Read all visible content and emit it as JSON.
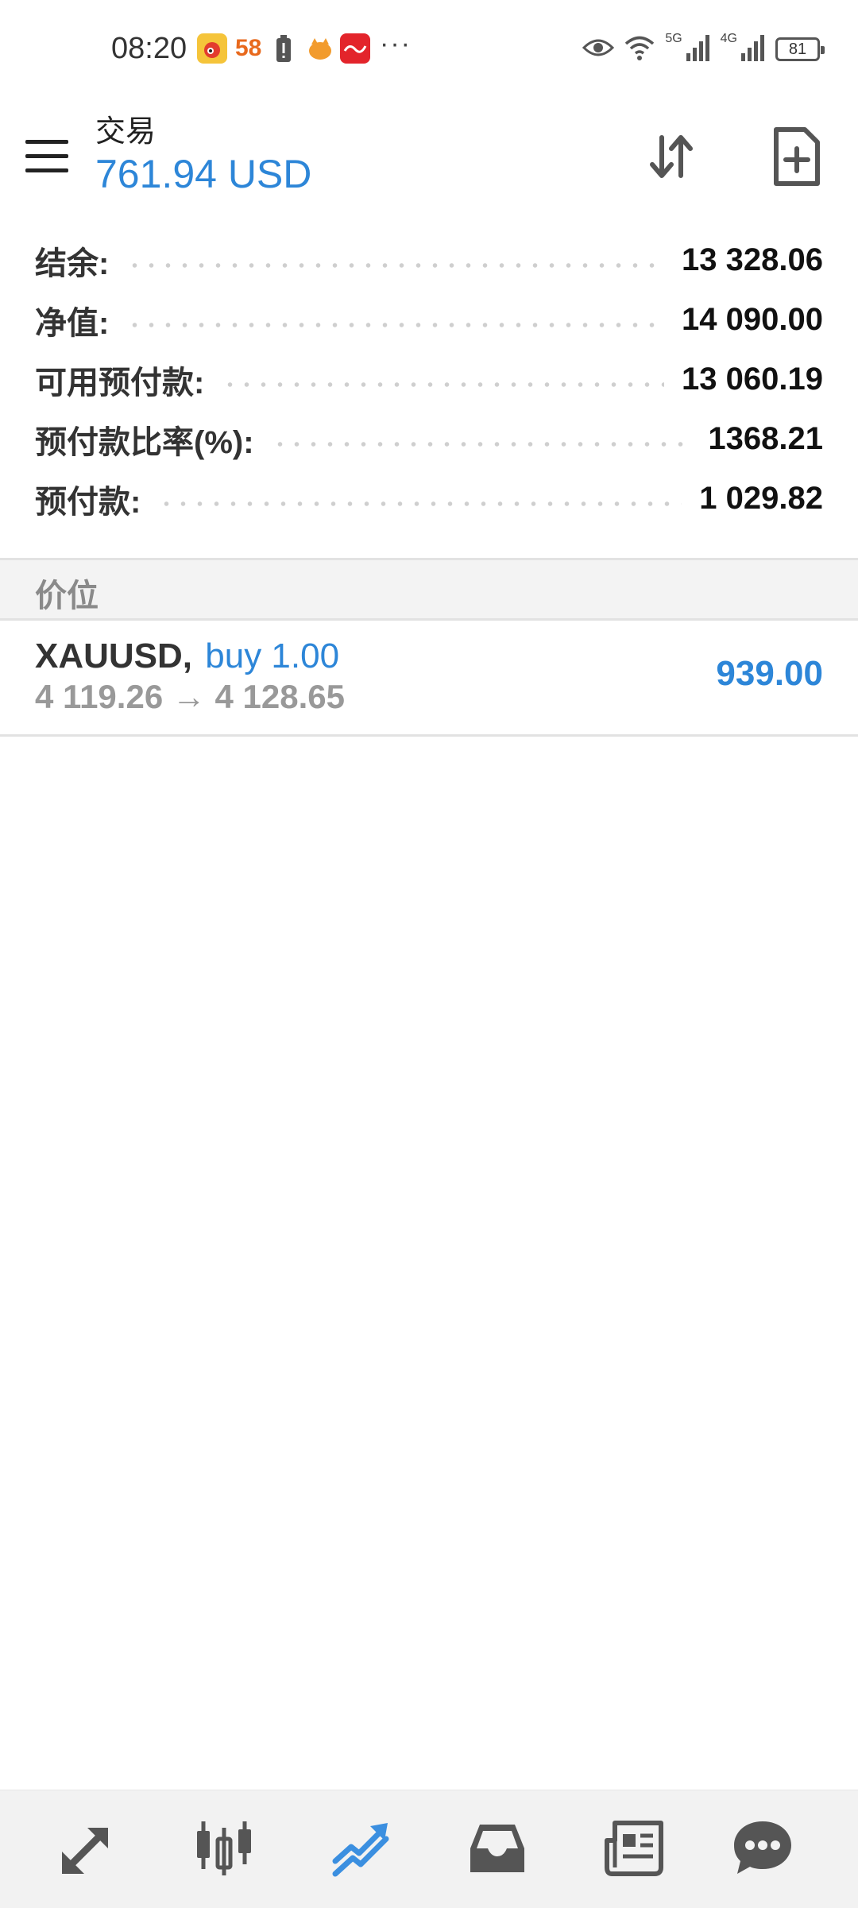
{
  "status_bar": {
    "time": "08:20",
    "badge_58": "58",
    "more": "···",
    "net_5g": "5G",
    "net_4g": "4G",
    "battery": "81",
    "icons": [
      "weibo-icon",
      "58-app-icon",
      "battery-alert-icon",
      "cat-app-icon",
      "red-app-icon",
      "eye-icon",
      "wifi-icon",
      "signal-5g-icon",
      "signal-4g-icon",
      "battery-icon"
    ]
  },
  "header": {
    "title": "交易",
    "balance": "761.94 USD",
    "sort_icon": "sort-arrows-icon",
    "new_order_icon": "new-document-icon"
  },
  "account": [
    {
      "label": "结余:",
      "value": "13 328.06"
    },
    {
      "label": "净值:",
      "value": "14 090.00"
    },
    {
      "label": "可用预付款:",
      "value": "13 060.19"
    },
    {
      "label": "预付款比率(%):",
      "value": "1368.21"
    },
    {
      "label": "预付款:",
      "value": "1 029.82"
    }
  ],
  "section_title": "价位",
  "position": {
    "symbol": "XAUUSD,",
    "type": "buy 1.00",
    "prices": "4 119.26 → 4 128.65",
    "profit": "939.00"
  },
  "bottom_nav": [
    {
      "name": "quotes",
      "icon": "quotes-arrows-icon",
      "active": false
    },
    {
      "name": "chart",
      "icon": "candlestick-icon",
      "active": false
    },
    {
      "name": "trade",
      "icon": "trade-trend-icon",
      "active": true
    },
    {
      "name": "history",
      "icon": "inbox-icon",
      "active": false
    },
    {
      "name": "news",
      "icon": "news-icon",
      "active": false
    },
    {
      "name": "messages",
      "icon": "chat-bubble-icon",
      "active": false
    }
  ],
  "colors": {
    "accent": "#2d86d8",
    "text": "#222222",
    "muted": "#999999",
    "nav_icon": "#555555"
  }
}
